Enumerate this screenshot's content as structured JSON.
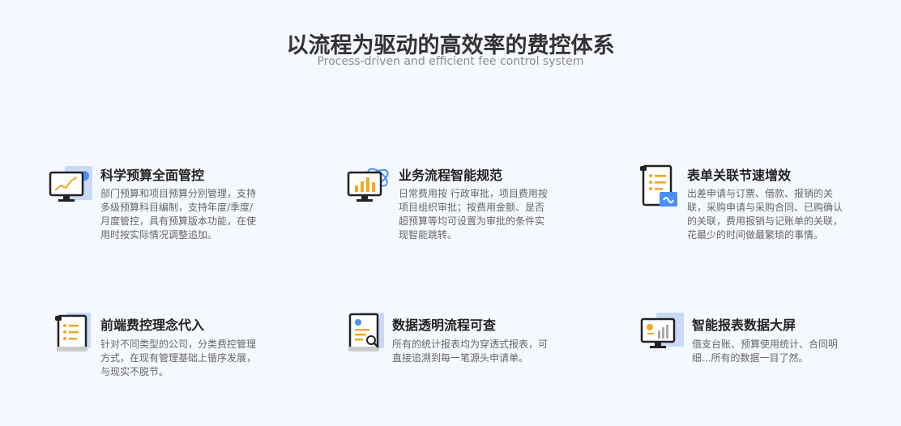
{
  "header": {
    "title": "以流程为驱动的高效率的费控体系",
    "subtitle": "Process-driven and efficient fee control system"
  },
  "features": [
    {
      "title": "科学预算全面管控",
      "icon": "monitor-chart-icon",
      "desc": [
        "部门预算和项目预算分别管理，支持",
        "多级预算科目编制，支持年度/季度/",
        "月度管控，具有预算版本功能，在使",
        "用时按实际情况调整追加。"
      ]
    },
    {
      "title": "业务流程智能规范",
      "icon": "monitor-bar-chart-icon",
      "desc": [
        "日常费用按 行政审批，项目费用按",
        "项目组织审批；按费用金额、是否",
        "超预算等均可设置为审批的条件实",
        "现智能跳转。"
      ]
    },
    {
      "title": "表单关联节速增效",
      "icon": "linked-document-icon",
      "desc": [
        "出差申请与订票、借款、报销的关",
        "联，采购申请与采购合同、已购确认",
        "的关联，费用报销与记账单的关联，",
        "花最少的时间做最繁琐的事情。"
      ]
    },
    {
      "title": "前端费控理念代入",
      "icon": "scroll-document-icon",
      "desc": [
        "针对不同类型的公司，分类费控管理",
        "方式，在现有管理基础上循序发展，",
        "与现实不脱节。"
      ]
    },
    {
      "title": "数据透明流程可查",
      "icon": "document-search-icon",
      "desc": [
        "所有的统计报表均为穿透式报表，可",
        "直接追溯到每一笔源头申请单。"
      ]
    },
    {
      "title": "智能报表数据大屏",
      "icon": "monitor-dashboard-icon",
      "desc": [
        "借支台账、预算使用统计、合同明",
        "细...所有的数据一目了然。"
      ]
    }
  ]
}
